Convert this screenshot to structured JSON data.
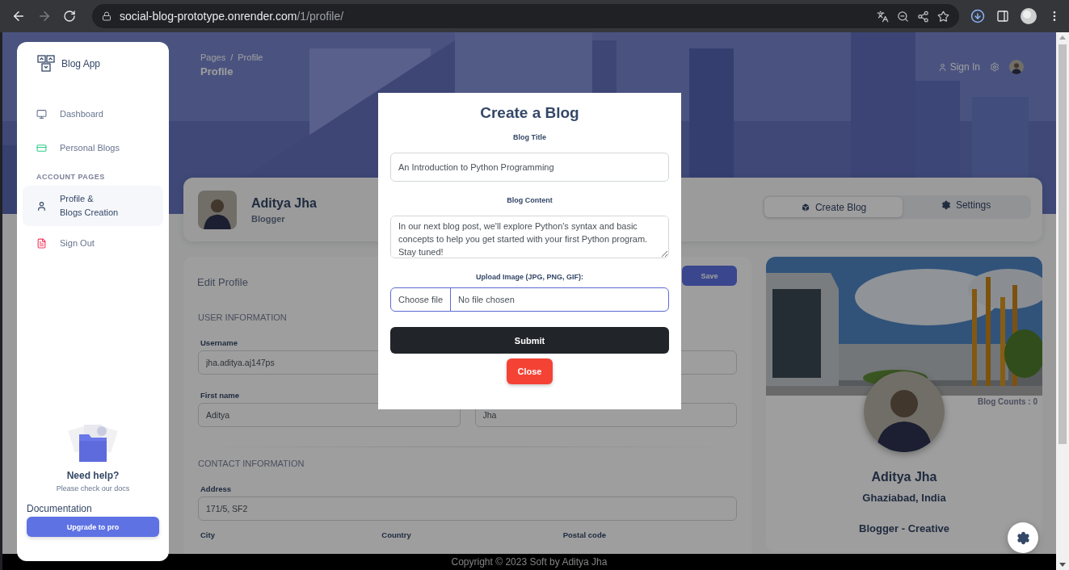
{
  "browser": {
    "url_host": "social-blog-prototype.onrender.com",
    "url_path": "/1/profile/"
  },
  "sidebar": {
    "brand": "Blog App",
    "items": [
      {
        "kind": "dashboard",
        "label": "Dashboard",
        "selected": false
      },
      {
        "kind": "blogs",
        "label": "Personal Blogs",
        "selected": false
      },
      {
        "kind": "heading",
        "label": "ACCOUNT PAGES"
      },
      {
        "kind": "profile",
        "label": "Profile &\nBlogs Creation",
        "selected": true
      },
      {
        "kind": "signout",
        "label": "Sign Out",
        "selected": false
      }
    ],
    "help": {
      "title": "Need help?",
      "text": "Please check our docs",
      "link": "Documentation",
      "button": "Upgrade to pro"
    }
  },
  "header": {
    "breadcrumbs": [
      "Pages",
      "Profile"
    ],
    "separator": "/",
    "title": "Profile",
    "sign_in": "Sign In"
  },
  "profile": {
    "name": "Aditya Jha",
    "role": "Blogger",
    "tabs": [
      {
        "label": "Create Blog",
        "selected": true
      },
      {
        "label": "Settings",
        "selected": false
      }
    ]
  },
  "edit_profile": {
    "title": "Edit Profile",
    "save": "Save",
    "sections": [
      {
        "title": "USER INFORMATION",
        "rows": [
          {
            "kind": "pair",
            "items": [
              {
                "label": "Username",
                "value": "jha.aditya.aj147ps"
              }
            ]
          },
          {
            "kind": "pair",
            "items": [
              {
                "label": "First name",
                "value": "Aditya"
              },
              {
                "value": "Jha"
              }
            ]
          }
        ]
      },
      {
        "title": "CONTACT INFORMATION",
        "rows": [
          {
            "kind": "single",
            "items": [
              {
                "label": "Address",
                "value": "171/5, SF2"
              }
            ]
          },
          {
            "kind": "labels",
            "items": [
              {
                "label": "City"
              },
              {
                "label": "Country"
              },
              {
                "label": "Postal code"
              }
            ]
          }
        ]
      }
    ]
  },
  "profile_card": {
    "blog_count": "Blog Counts : 0",
    "name": "Aditya Jha",
    "location": "Ghaziabad, India",
    "title": "Blogger - Creative"
  },
  "modal": {
    "title": "Create a Blog",
    "fields": [
      {
        "kind": "text",
        "label": "Blog Title",
        "value": "An Introduction to Python Programming"
      },
      {
        "kind": "textarea",
        "label": "Blog Content",
        "value": "In our next blog post, we'll explore Python's syntax and basic concepts to help you get started with your first Python program. Stay tuned!"
      },
      {
        "kind": "file",
        "label": "Upload Image (JPG, PNG, GIF):",
        "button": "Choose file",
        "value": "No file chosen"
      }
    ],
    "submit": "Submit",
    "close": "Close"
  },
  "footer": "Copyright © 2023 Soft by Aditya Jha"
}
